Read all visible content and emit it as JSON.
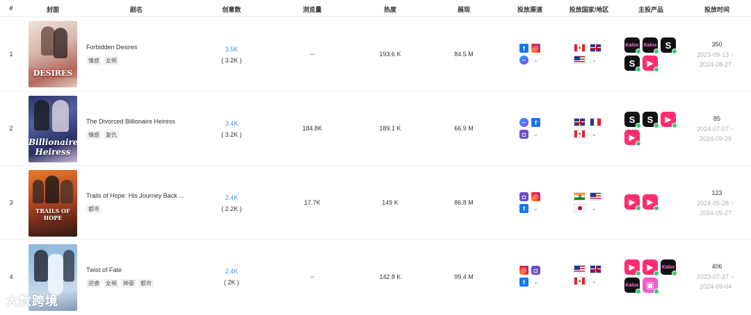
{
  "headers": {
    "index": "#",
    "cover": "封面",
    "drama": "剧名",
    "creatives": "创意数",
    "views": "浏览量",
    "heat": "热度",
    "impressions": "展现",
    "channels": "投放渠道",
    "countries": "投放国家/地区",
    "products": "主投产品",
    "time": "投放时间"
  },
  "rows": [
    {
      "index": "1",
      "cover_text": "DESIRES",
      "title": "Forbidden Desires",
      "tags": [
        "情感",
        "女频"
      ],
      "creatives": "3.5K",
      "creatives_sub": "( 3.2K )",
      "views": "--",
      "heat": "193.6 K",
      "impressions": "84.5 M",
      "channels": [
        "facebook-icon",
        "instagram-icon",
        "messenger-icon",
        "chevron-down-icon"
      ],
      "flags": [
        "canada-flag",
        "uk-flag",
        "us-flag",
        "chevron-down-icon"
      ],
      "products": [
        "kalos-app",
        "kalos-app",
        "s-app",
        "s-app",
        "reel-app"
      ],
      "count": "350",
      "date_from": "2023-09-13 ~",
      "date_to": "2024-08-27"
    },
    {
      "index": "2",
      "cover_text": "Billionaire Heiress",
      "title": "The Divorced Billionaire Heiress",
      "tags": [
        "情感",
        "复仇"
      ],
      "creatives": "3.4K",
      "creatives_sub": "( 3.2K )",
      "views": "184.8K",
      "heat": "189.1 K",
      "impressions": "66.9 M",
      "channels": [
        "messenger-icon",
        "facebook-icon",
        "square-icon",
        "chevron-down-icon"
      ],
      "flags": [
        "uk-flag",
        "france-flag",
        "canada-flag",
        "chevron-down-icon"
      ],
      "products": [
        "s-app",
        "s-app",
        "reel-app",
        "reel-app"
      ],
      "count": "85",
      "date_from": "2024-07-07 ~",
      "date_to": "2024-09-29"
    },
    {
      "index": "3",
      "cover_text": "TRAILS OF HOPE",
      "title": "Trails of Hope: His Journey Back ...",
      "tags": [
        "都市"
      ],
      "creatives": "2.4K",
      "creatives_sub": "( 2.2K )",
      "views": "17.7K",
      "heat": "149 K",
      "impressions": "86.8 M",
      "channels": [
        "square-icon",
        "instagram-icon",
        "facebook-icon",
        "chevron-down-icon"
      ],
      "flags": [
        "india-flag",
        "us-flag",
        "japan-flag",
        "chevron-down-icon"
      ],
      "products": [
        "reel-app",
        "reel-app"
      ],
      "count": "123",
      "date_from": "2024-05-28 ~",
      "date_to": "2024-09-27"
    },
    {
      "index": "4",
      "cover_text": "",
      "title": "Twist of Fate",
      "tags": [
        "逆袭",
        "女频",
        "神豪",
        "都市"
      ],
      "creatives": "2.4K",
      "creatives_sub": "( 2K )",
      "views": "--",
      "heat": "142.8 K",
      "impressions": "99.4 M",
      "channels": [
        "instagram-icon",
        "square-icon",
        "facebook-icon",
        "chevron-down-icon"
      ],
      "flags": [
        "us-flag",
        "uk-flag",
        "canada-flag",
        "chevron-down-icon"
      ],
      "products": [
        "reel-app",
        "reel-app",
        "kalos-app",
        "kalos-app",
        "pink-app"
      ],
      "count": "406",
      "date_from": "2023-07-27 ~",
      "date_to": "2024-09-04"
    }
  ],
  "watermark": "大数跨境",
  "colors": {
    "link": "#3d8ff0",
    "muted_date": "#aab0b8",
    "facebook": "#1877f2",
    "reel": "#ff2d6f"
  }
}
